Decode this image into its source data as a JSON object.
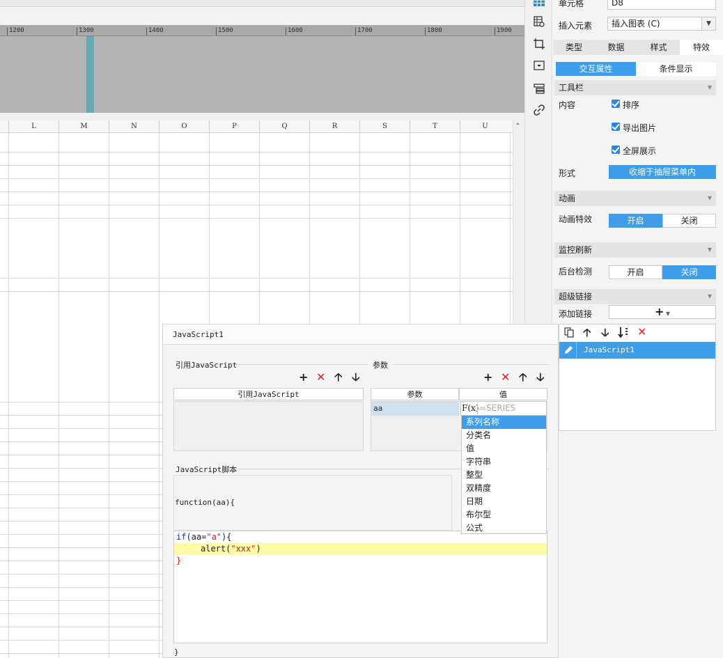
{
  "ruler": {
    "ticks": [
      "1200",
      "1300",
      "1400",
      "1500",
      "1600",
      "1700",
      "1800",
      "1900"
    ]
  },
  "grid": {
    "columns": [
      "L",
      "M",
      "N",
      "O",
      "P",
      "Q",
      "R",
      "S",
      "T",
      "U"
    ]
  },
  "side_icons": [
    "grid-table-icon",
    "cell-properties-icon",
    "crop-frame-icon",
    "dropdown-box-icon",
    "layer-stack-icon",
    "hyperlink-icon"
  ],
  "panel": {
    "cell_label": "单元格",
    "cell_value": "D8",
    "insert_label": "插入元素",
    "insert_value": "插入图表 (C)",
    "tabs": [
      "类型",
      "数据",
      "样式",
      "特效"
    ],
    "active_tab": "特效",
    "subtabs": [
      "交互属性",
      "条件显示"
    ],
    "toolbar_section": "工具栏",
    "content_label": "内容",
    "checks": [
      "排序",
      "导出图片",
      "全屏展示"
    ],
    "form_label": "形式",
    "form_value": "收缩于抽屉菜单内",
    "animation_section": "动画",
    "animation_label": "动画特效",
    "animation_on": "开启",
    "animation_off": "关闭",
    "monitor_section": "监控刷新",
    "monitor_label": "后台检测",
    "monitor_on": "开启",
    "monitor_off": "关闭",
    "hyperlink_section": "超级链接",
    "addlink_label": "添加链接",
    "addlink_button": "+",
    "link_items": [
      "JavaScript1"
    ]
  },
  "dialog": {
    "title": "JavaScript1",
    "ref_group": "引用JavaScript",
    "ref_header": "引用JavaScript",
    "param_group": "参数",
    "param_col": "参数",
    "value_col": "值",
    "param_rows": [
      {
        "name": "aa"
      }
    ],
    "formula_prefix": "F(x)",
    "formula_placeholder": "=SERIES",
    "dropdown": [
      "系列名称",
      "分类名",
      "值",
      "字符串",
      "整型",
      "双精度",
      "日期",
      "布尔型",
      "公式"
    ],
    "dropdown_selected": "系列名称",
    "script_group": "JavaScript脚本",
    "fn_header": "function(aa){",
    "code": {
      "line1_kw": "if",
      "line1_mid": "(aa=",
      "line1_str": "\"a\"",
      "line1_end": "){",
      "line2_fn": "alert(",
      "line2_str": "\"xxx\"",
      "line2_end": ")",
      "line3": "}"
    },
    "closing_brace": "}"
  },
  "colors": {
    "accent": "#3f9dea",
    "delete": "#e02020",
    "highlight": "#fdfaa8",
    "playhead": "#6aa7b1"
  }
}
